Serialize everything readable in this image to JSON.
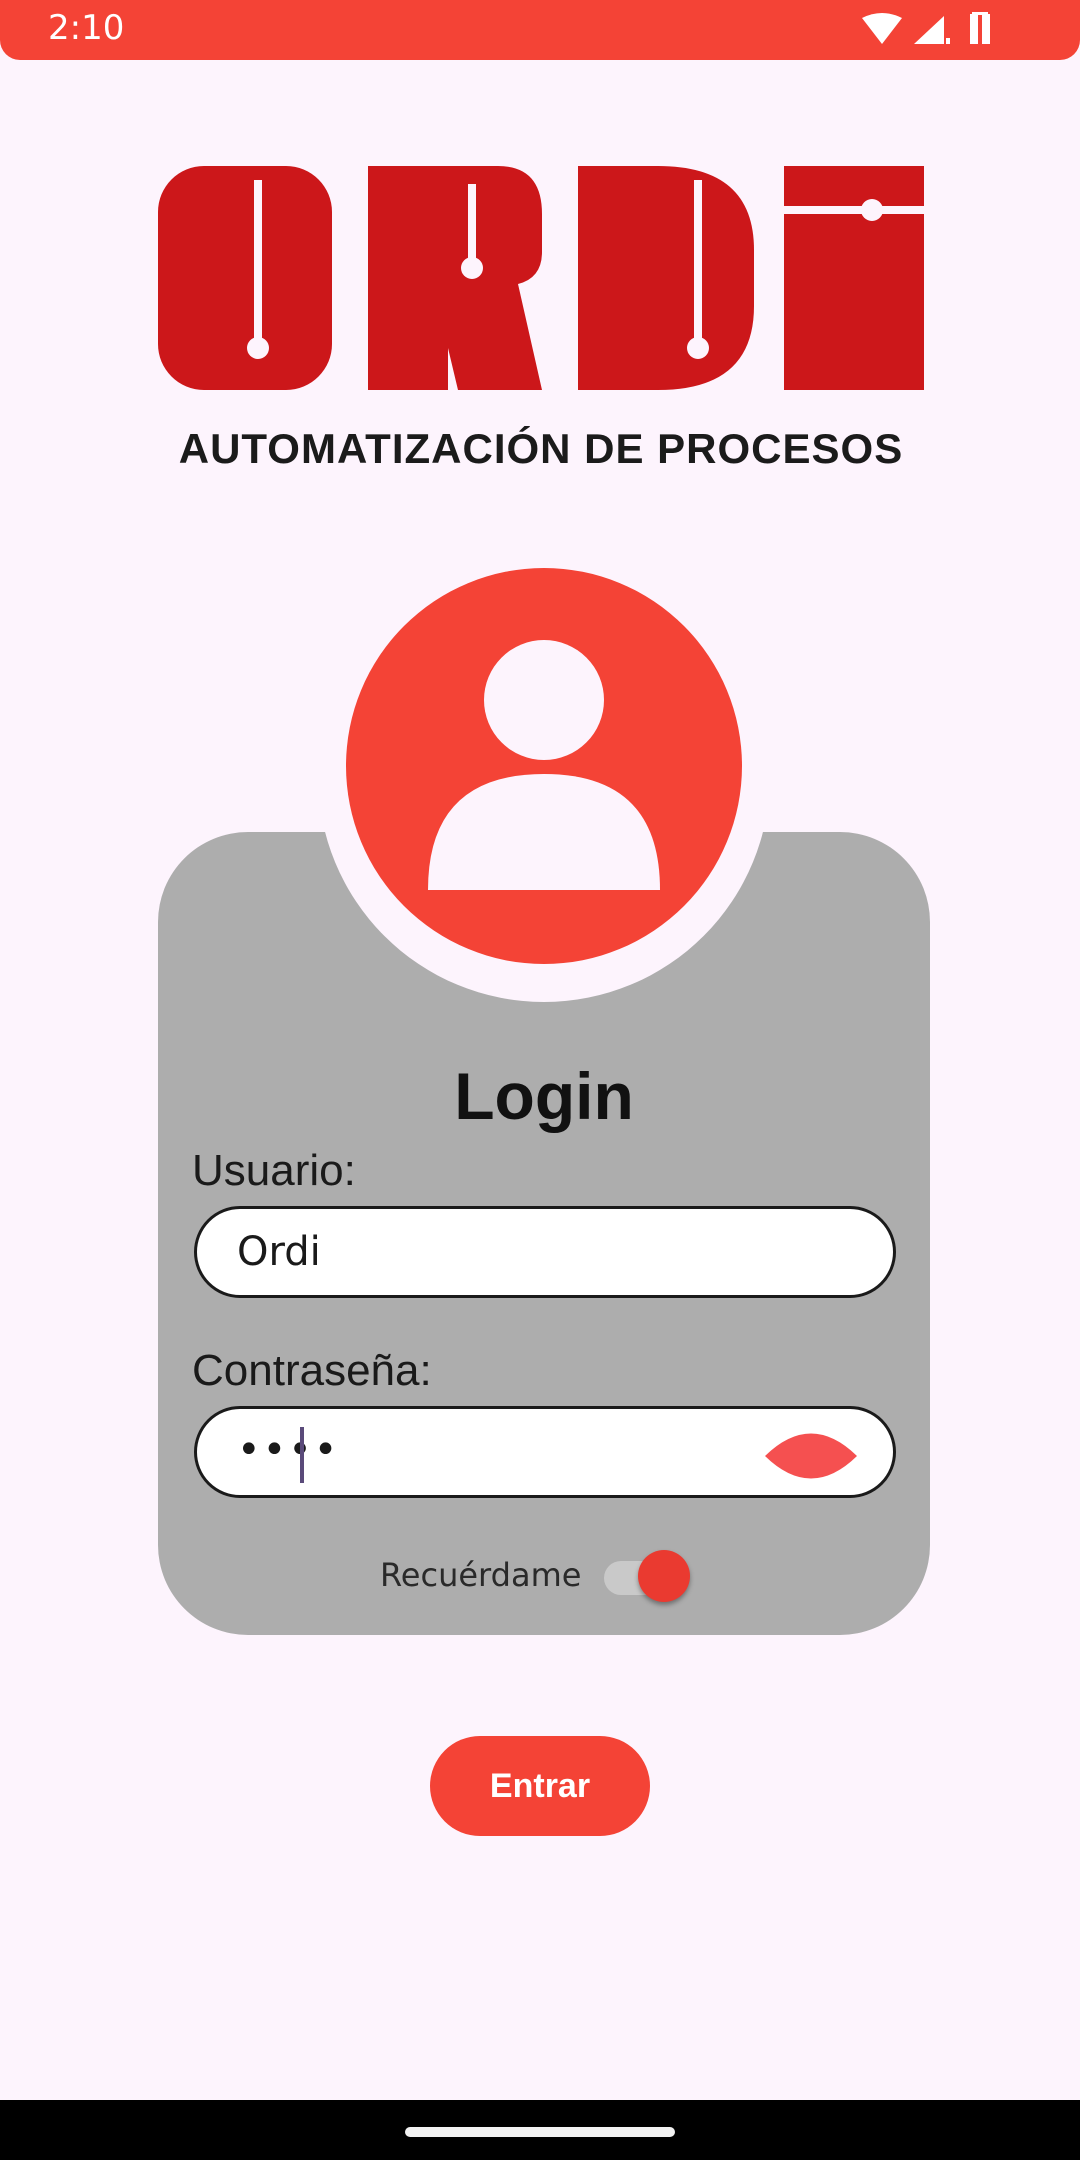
{
  "status_bar": {
    "time": "2:10",
    "icons": [
      "wifi-icon",
      "signal-icon",
      "battery-icon"
    ],
    "color": "#f44336"
  },
  "logo": {
    "wordmark": "ORDi",
    "tagline": "AUTOMATIZACIÓN DE PROCESOS",
    "color": "#cc171a"
  },
  "login": {
    "title": "Login",
    "user_label": "Usuario:",
    "user_value": "Ordi",
    "password_label": "Contraseña:",
    "password_value": "••••",
    "show_password_icon": "eye-icon",
    "remember_label": "Recuérdame",
    "remember_on": true,
    "submit_label": "Entrar"
  },
  "colors": {
    "accent": "#f44336",
    "card": "#adadad",
    "background": "#fdf4fd"
  }
}
